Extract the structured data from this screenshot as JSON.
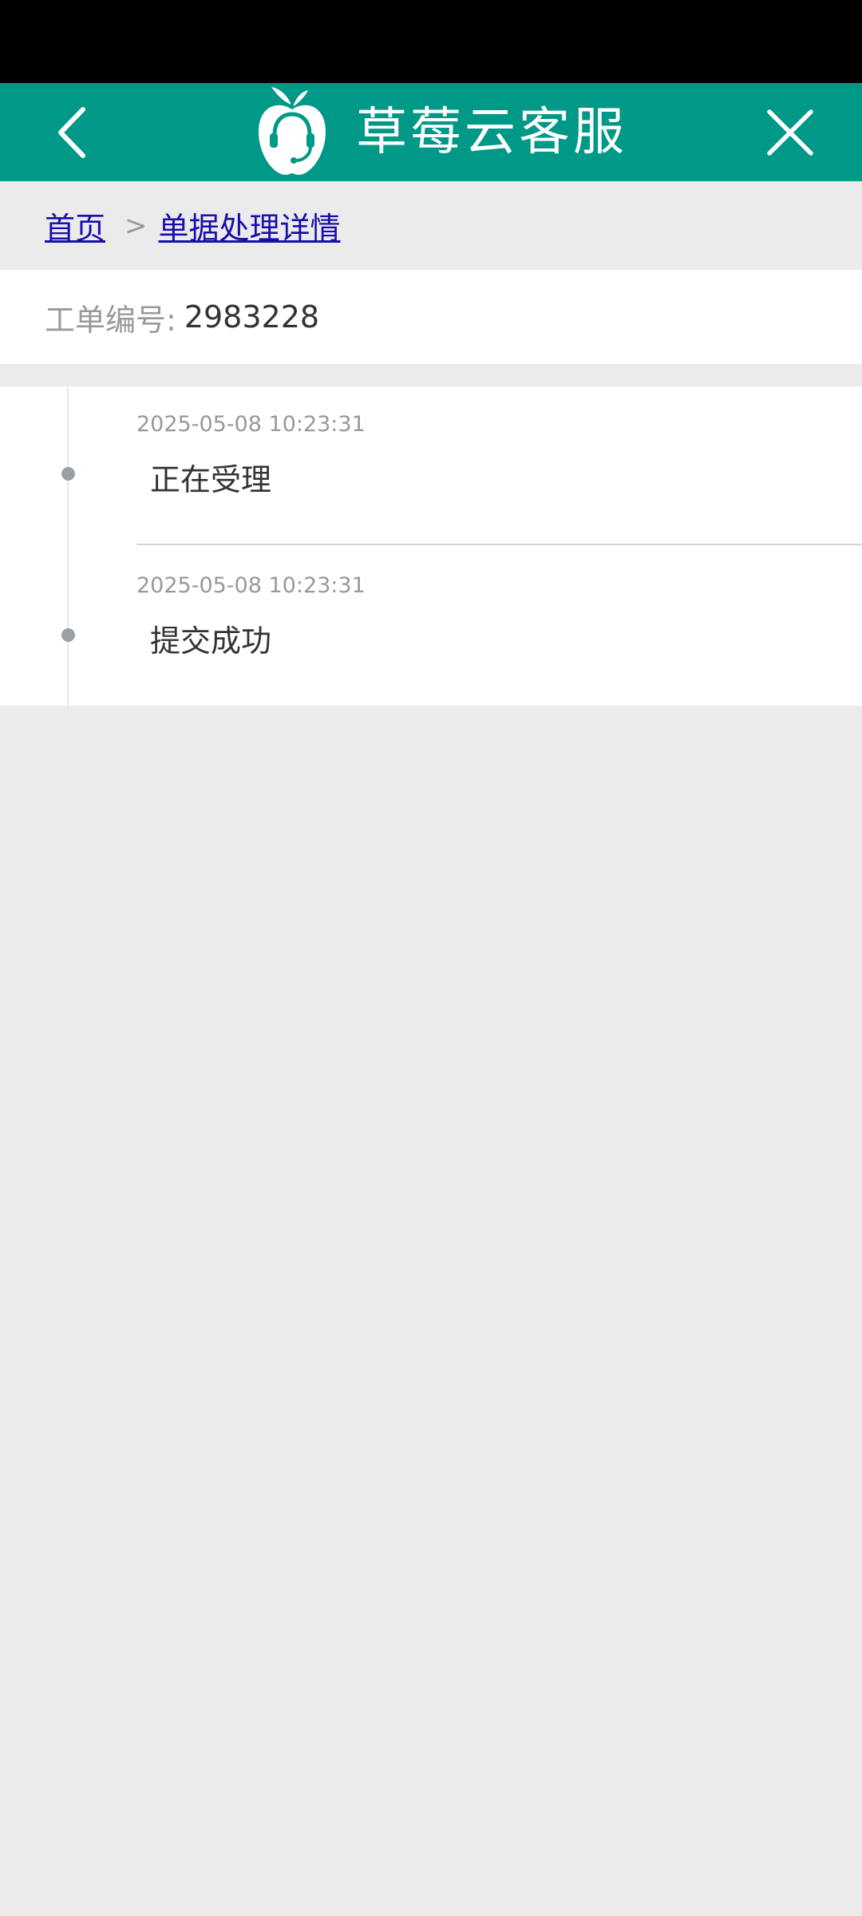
{
  "header": {
    "app_name": "草莓云客服",
    "back_icon": "chevron-left-icon",
    "close_icon": "close-icon",
    "logo_icon": "apple-headset-logo",
    "color": "#009886"
  },
  "breadcrumb": {
    "home": "首页",
    "separator": ">",
    "current": "单据处理详情",
    "link_color": "#1a0dab"
  },
  "order": {
    "label": "工单编号:",
    "number": "2983228"
  },
  "timeline": [
    {
      "time": "2025-05-08 10:23:31",
      "status": "正在受理"
    },
    {
      "time": "2025-05-08 10:23:31",
      "status": "提交成功"
    }
  ]
}
